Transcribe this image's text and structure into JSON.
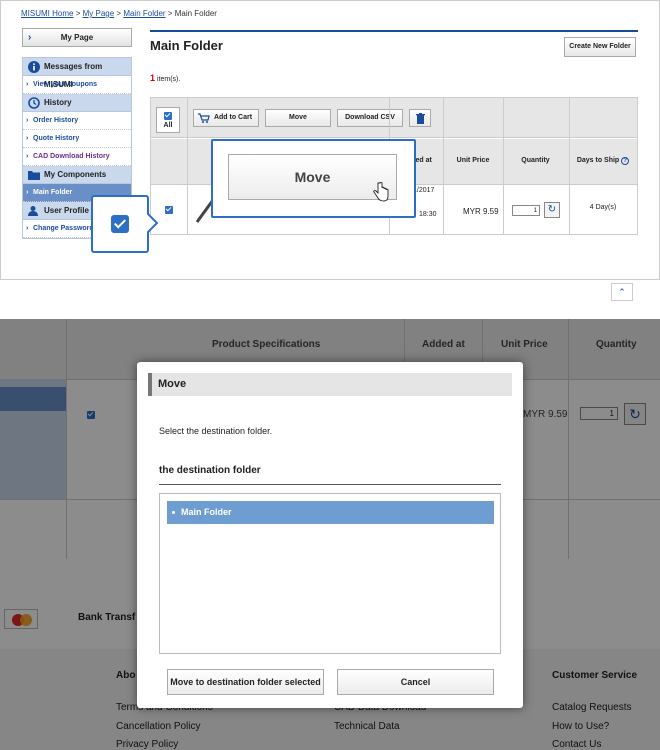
{
  "breadcrumb": {
    "home": "MISUMI Home",
    "mypage": "My Page",
    "main": "Main Folder",
    "current": "Main Folder",
    "sep": ">"
  },
  "sidebar": {
    "mypage": "My Page",
    "messages_header": "Messages from MISUMI",
    "view_coupons": "View your coupons",
    "history_header": "History",
    "order_history": "Order History",
    "quote_history": "Quote History",
    "cad_history": "CAD Download History",
    "components_header": "My Components",
    "main_folder": "Main Folder",
    "profile_header": "User Profile",
    "change_password": "Change Password"
  },
  "main": {
    "title": "Main Folder",
    "create_button": "Create New Folder",
    "item_count": "1",
    "item_label": "item(s).",
    "toolbar": {
      "all": "All",
      "add_to_cart": "Add to Cart",
      "move": "Move",
      "download_csv": "Download CSV"
    },
    "columns": {
      "added_at": "ded at",
      "unit_price": "Unit Price",
      "quantity": "Quantity",
      "days_to_ship": "Days to Ship"
    },
    "row": {
      "date": "1/2017",
      "time": "18:30",
      "price": "MYR 9.59",
      "qty": "1",
      "days": "4 Day(s)"
    }
  },
  "popup": {
    "move": "Move"
  },
  "background": {
    "product_specs": "Product Specifications",
    "added_at": "Added at",
    "unit_price": "Unit Price",
    "quantity": "Quantity",
    "price": "MYR 9.59",
    "qty": "1",
    "bank": "Bank Transf",
    "about": "Abo",
    "customer_service": "Customer Service",
    "terms": "Terms and Conditions",
    "cancel_policy": "Cancellation Policy",
    "privacy": "Privacy Policy",
    "cad": "CAD Data Download",
    "technical": "Technical Data",
    "catalog": "Catalog Requests",
    "howto": "How to Use?",
    "contact": "Contact Us"
  },
  "modal": {
    "title": "Move",
    "message": "Select the destination folder.",
    "dest_label": "the destination folder",
    "option": "Main Folder",
    "move_button": "Move to destination folder selected",
    "cancel_button": "Cancel"
  }
}
